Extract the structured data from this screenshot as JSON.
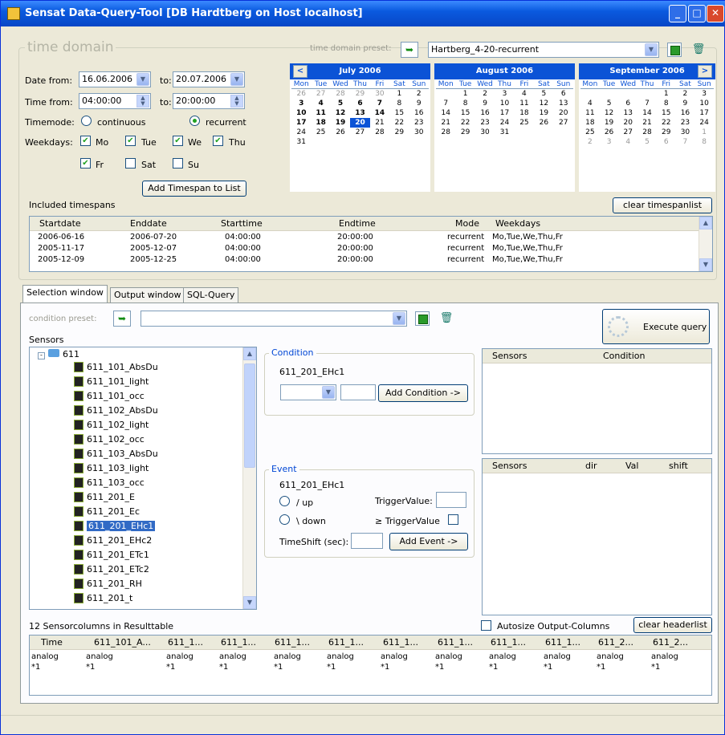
{
  "window": {
    "title": "Sensat Data-Query-Tool [DB Hardtberg on Host localhost]",
    "minimize": "_",
    "maximize": "□",
    "close": "✕"
  },
  "time_domain": {
    "label": "time domain",
    "preset_label": "time domain preset:",
    "preset_value": "Hartberg_4-20-recurrent",
    "date_from_label": "Date from:",
    "date_from": "16.06.2006",
    "date_to_label": "to:",
    "date_to": "20.07.2006",
    "time_from_label": "Time from:",
    "time_from": "04:00:00",
    "time_to_label": "to:",
    "time_to": "20:00:00",
    "timemode_label": "Timemode:",
    "timemode_continuous": "continuous",
    "timemode_recurrent": "recurrent",
    "weekdays_label": "Weekdays:",
    "days": [
      {
        "label": "Mo",
        "checked": true
      },
      {
        "label": "Tue",
        "checked": true
      },
      {
        "label": "We",
        "checked": true
      },
      {
        "label": "Thu",
        "checked": true
      },
      {
        "label": "Fr",
        "checked": true
      },
      {
        "label": "Sat",
        "checked": false
      },
      {
        "label": "Su",
        "checked": false
      }
    ],
    "add_timespan_label": "Add Timespan to List",
    "check_mark": "✔"
  },
  "calendars": [
    {
      "month": "July 2006",
      "nav": "<",
      "dow": [
        "Mon",
        "Tue",
        "Wed",
        "Thu",
        "Fri",
        "Sat",
        "Sun"
      ],
      "days": [
        "26",
        "27",
        "28",
        "29",
        "30",
        "1",
        "2",
        "3",
        "4",
        "5",
        "6",
        "7",
        "8",
        "9",
        "10",
        "11",
        "12",
        "13",
        "14",
        "15",
        "16",
        "17",
        "18",
        "19",
        "20",
        "21",
        "22",
        "23",
        "24",
        "25",
        "26",
        "27",
        "28",
        "29",
        "30",
        "31"
      ]
    },
    {
      "month": "August 2006",
      "nav": "",
      "dow": [
        "Mon",
        "Tue",
        "Wed",
        "Thu",
        "Fri",
        "Sat",
        "Sun"
      ],
      "days": [
        "",
        "1",
        "2",
        "3",
        "4",
        "5",
        "6",
        "7",
        "8",
        "9",
        "10",
        "11",
        "12",
        "13",
        "14",
        "15",
        "16",
        "17",
        "18",
        "19",
        "20",
        "21",
        "22",
        "23",
        "24",
        "25",
        "26",
        "27",
        "28",
        "29",
        "30",
        "31"
      ]
    },
    {
      "month": "September 2006",
      "nav": ">",
      "dow": [
        "Mon",
        "Tue",
        "Wed",
        "Thu",
        "Fri",
        "Sat",
        "Sun"
      ],
      "days": [
        "",
        "",
        "",
        "",
        "1",
        "2",
        "3",
        "4",
        "5",
        "6",
        "7",
        "8",
        "9",
        "10",
        "11",
        "12",
        "13",
        "14",
        "15",
        "16",
        "17",
        "18",
        "19",
        "20",
        "21",
        "22",
        "23",
        "24",
        "25",
        "26",
        "27",
        "28",
        "29",
        "30",
        "1",
        "2",
        "3",
        "4",
        "5",
        "6",
        "7",
        "8"
      ]
    }
  ],
  "timespans": {
    "label": "Included timespans",
    "clear_label": "clear timespanlist",
    "columns": [
      "Startdate",
      "Enddate",
      "Starttime",
      "Endtime",
      "Mode",
      "Weekdays"
    ],
    "rows": [
      [
        "2006-06-16",
        "2006-07-20",
        "04:00:00",
        "20:00:00",
        "recurrent",
        "Mo,Tue,We,Thu,Fr"
      ],
      [
        "2005-11-17",
        "2005-12-07",
        "04:00:00",
        "20:00:00",
        "recurrent",
        "Mo,Tue,We,Thu,Fr"
      ],
      [
        "2005-12-09",
        "2005-12-25",
        "04:00:00",
        "20:00:00",
        "recurrent",
        "Mo,Tue,We,Thu,Fr"
      ]
    ]
  },
  "tabs": [
    "Selection window",
    "Output window",
    "SQL-Query"
  ],
  "selection": {
    "condition_preset_label": "condition preset:",
    "condition_preset_value": "",
    "execute_label": "Execute query",
    "sensors_label": "Sensors",
    "root": "611",
    "sensors": [
      "611_101_AbsDu",
      "611_101_light",
      "611_101_occ",
      "611_102_AbsDu",
      "611_102_light",
      "611_102_occ",
      "611_103_AbsDu",
      "611_103_light",
      "611_103_occ",
      "611_201_E",
      "611_201_Ec",
      "611_201_EHc1",
      "611_201_EHc2",
      "611_201_ETc1",
      "611_201_ETc2",
      "611_201_RH",
      "611_201_t"
    ],
    "selected_sensor": "611_201_EHc1",
    "condition": {
      "label": "Condition",
      "sensor": "611_201_EHc1",
      "add_label": "Add Condition ->"
    },
    "event": {
      "label": "Event",
      "sensor": "611_201_EHc1",
      "up_label": "/  up",
      "down_label": "\\  down",
      "trigger_label": "TriggerValue:",
      "ge_trigger_label": "≥ TriggerValue",
      "timeshift_label": "TimeShift (sec):",
      "add_label": "Add Event ->"
    },
    "cond_table": {
      "columns": [
        "Sensors",
        "Condition"
      ]
    },
    "event_table": {
      "columns": [
        "Sensors",
        "dir",
        "Val",
        "shift"
      ]
    }
  },
  "result": {
    "count_label": "12 Sensorcolumns in Resulttable",
    "autosize_label": "Autosize Output-Columns",
    "clear_label": "clear headerlist",
    "columns": [
      "Time",
      "611_101_A...",
      "611_1...",
      "611_1...",
      "611_1...",
      "611_1...",
      "611_1...",
      "611_1...",
      "611_1...",
      "611_1...",
      "611_2...",
      "611_2..."
    ],
    "row1": [
      "analog",
      "analog",
      "analog",
      "analog",
      "analog",
      "analog",
      "analog",
      "analog",
      "analog",
      "analog",
      "analog",
      "analog"
    ],
    "row2": [
      "*1",
      "*1",
      "*1",
      "*1",
      "*1",
      "*1",
      "*1",
      "*1",
      "*1",
      "*1",
      "*1",
      "*1"
    ]
  }
}
